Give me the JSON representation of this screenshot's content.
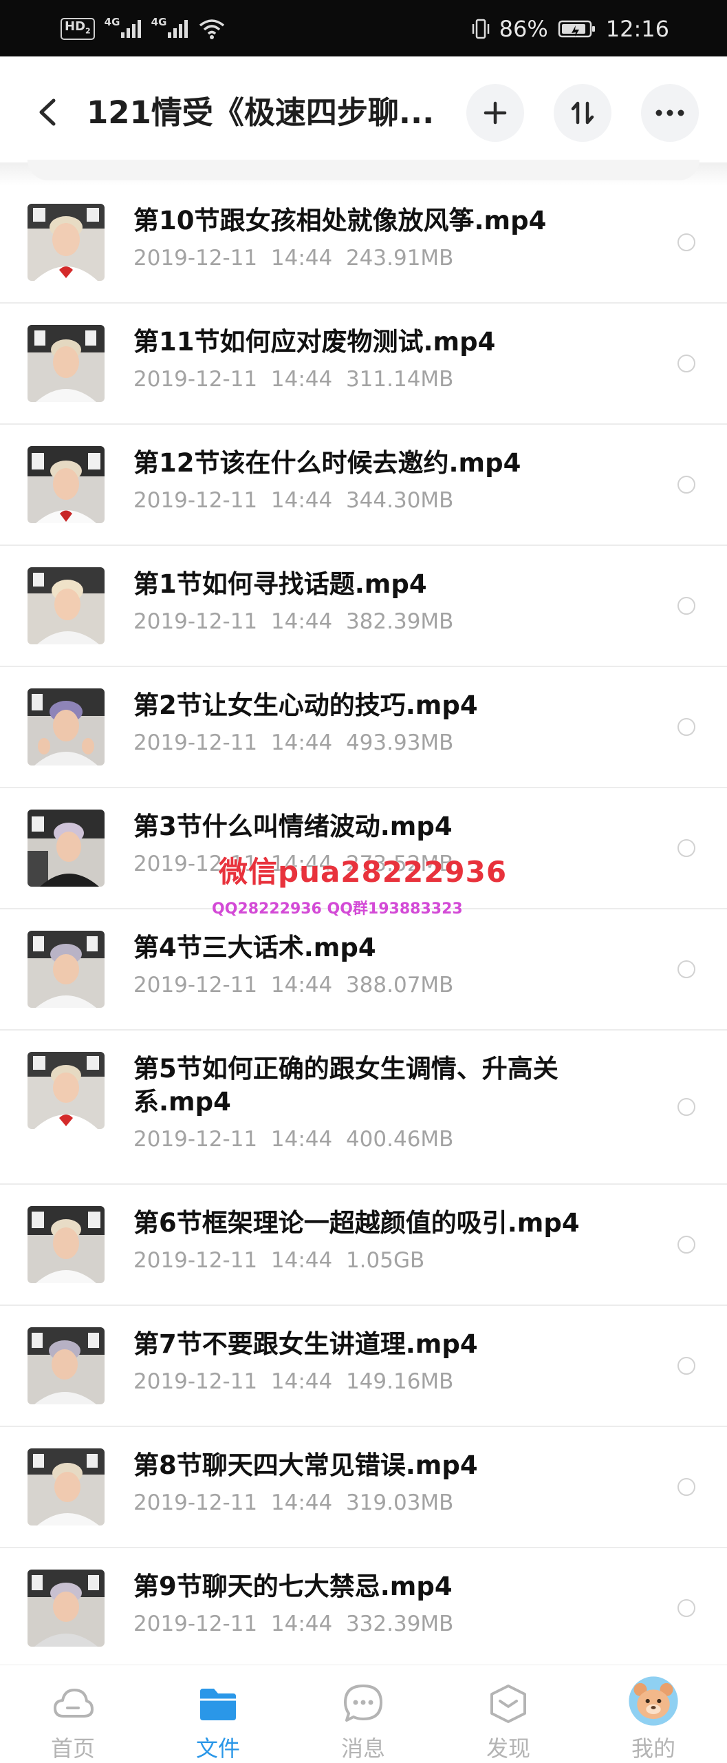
{
  "status_bar": {
    "network_badge": "HD",
    "network_badge_sub": "2",
    "signal1_label": "4G",
    "signal2_label": "4G",
    "battery_percent": "86%",
    "time": "12:16"
  },
  "header": {
    "title": "121情受《极速四步聊...",
    "back_icon": "chevron-left-icon",
    "add_icon": "plus-icon",
    "sort_icon": "sort-icon",
    "more_icon": "more-dots-icon"
  },
  "files": [
    {
      "name": "第10节跟女孩相处就像放风筝.mp4",
      "date": "2019-12-11",
      "time": "14:44",
      "size": "243.91MB"
    },
    {
      "name": "第11节如何应对废物测试.mp4",
      "date": "2019-12-11",
      "time": "14:44",
      "size": "311.14MB"
    },
    {
      "name": "第12节该在什么时候去邀约.mp4",
      "date": "2019-12-11",
      "time": "14:44",
      "size": "344.30MB"
    },
    {
      "name": "第1节如何寻找话题.mp4",
      "date": "2019-12-11",
      "time": "14:44",
      "size": "382.39MB"
    },
    {
      "name": "第2节让女生心动的技巧.mp4",
      "date": "2019-12-11",
      "time": "14:44",
      "size": "493.93MB"
    },
    {
      "name": "第3节什么叫情绪波动.mp4",
      "date": "2019-12-11",
      "time": "14:44",
      "size": "273.52MB"
    },
    {
      "name": "第4节三大话术.mp4",
      "date": "2019-12-11",
      "time": "14:44",
      "size": "388.07MB"
    },
    {
      "name": "第5节如何正确的跟女生调情、升高关系.mp4",
      "date": "2019-12-11",
      "time": "14:44",
      "size": "400.46MB"
    },
    {
      "name": "第6节框架理论一超越颜值的吸引.mp4",
      "date": "2019-12-11",
      "time": "14:44",
      "size": "1.05GB"
    },
    {
      "name": "第7节不要跟女生讲道理.mp4",
      "date": "2019-12-11",
      "time": "14:44",
      "size": "149.16MB"
    },
    {
      "name": "第8节聊天四大常见错误.mp4",
      "date": "2019-12-11",
      "time": "14:44",
      "size": "319.03MB"
    },
    {
      "name": "第9节聊天的七大禁忌.mp4",
      "date": "2019-12-11",
      "time": "14:44",
      "size": "332.39MB"
    }
  ],
  "watermark": {
    "line1": "微信pua28222936",
    "line2": "QQ28222936 QQ群193883323"
  },
  "bottom_nav": {
    "tabs": [
      {
        "label": "首页",
        "icon": "cloud-icon"
      },
      {
        "label": "文件",
        "icon": "folder-icon"
      },
      {
        "label": "消息",
        "icon": "chat-icon"
      },
      {
        "label": "发现",
        "icon": "discover-icon"
      },
      {
        "label": "我的",
        "icon": "avatar-icon"
      }
    ],
    "active_color": "#2a97e8",
    "inactive_color": "#b4b4b4"
  }
}
